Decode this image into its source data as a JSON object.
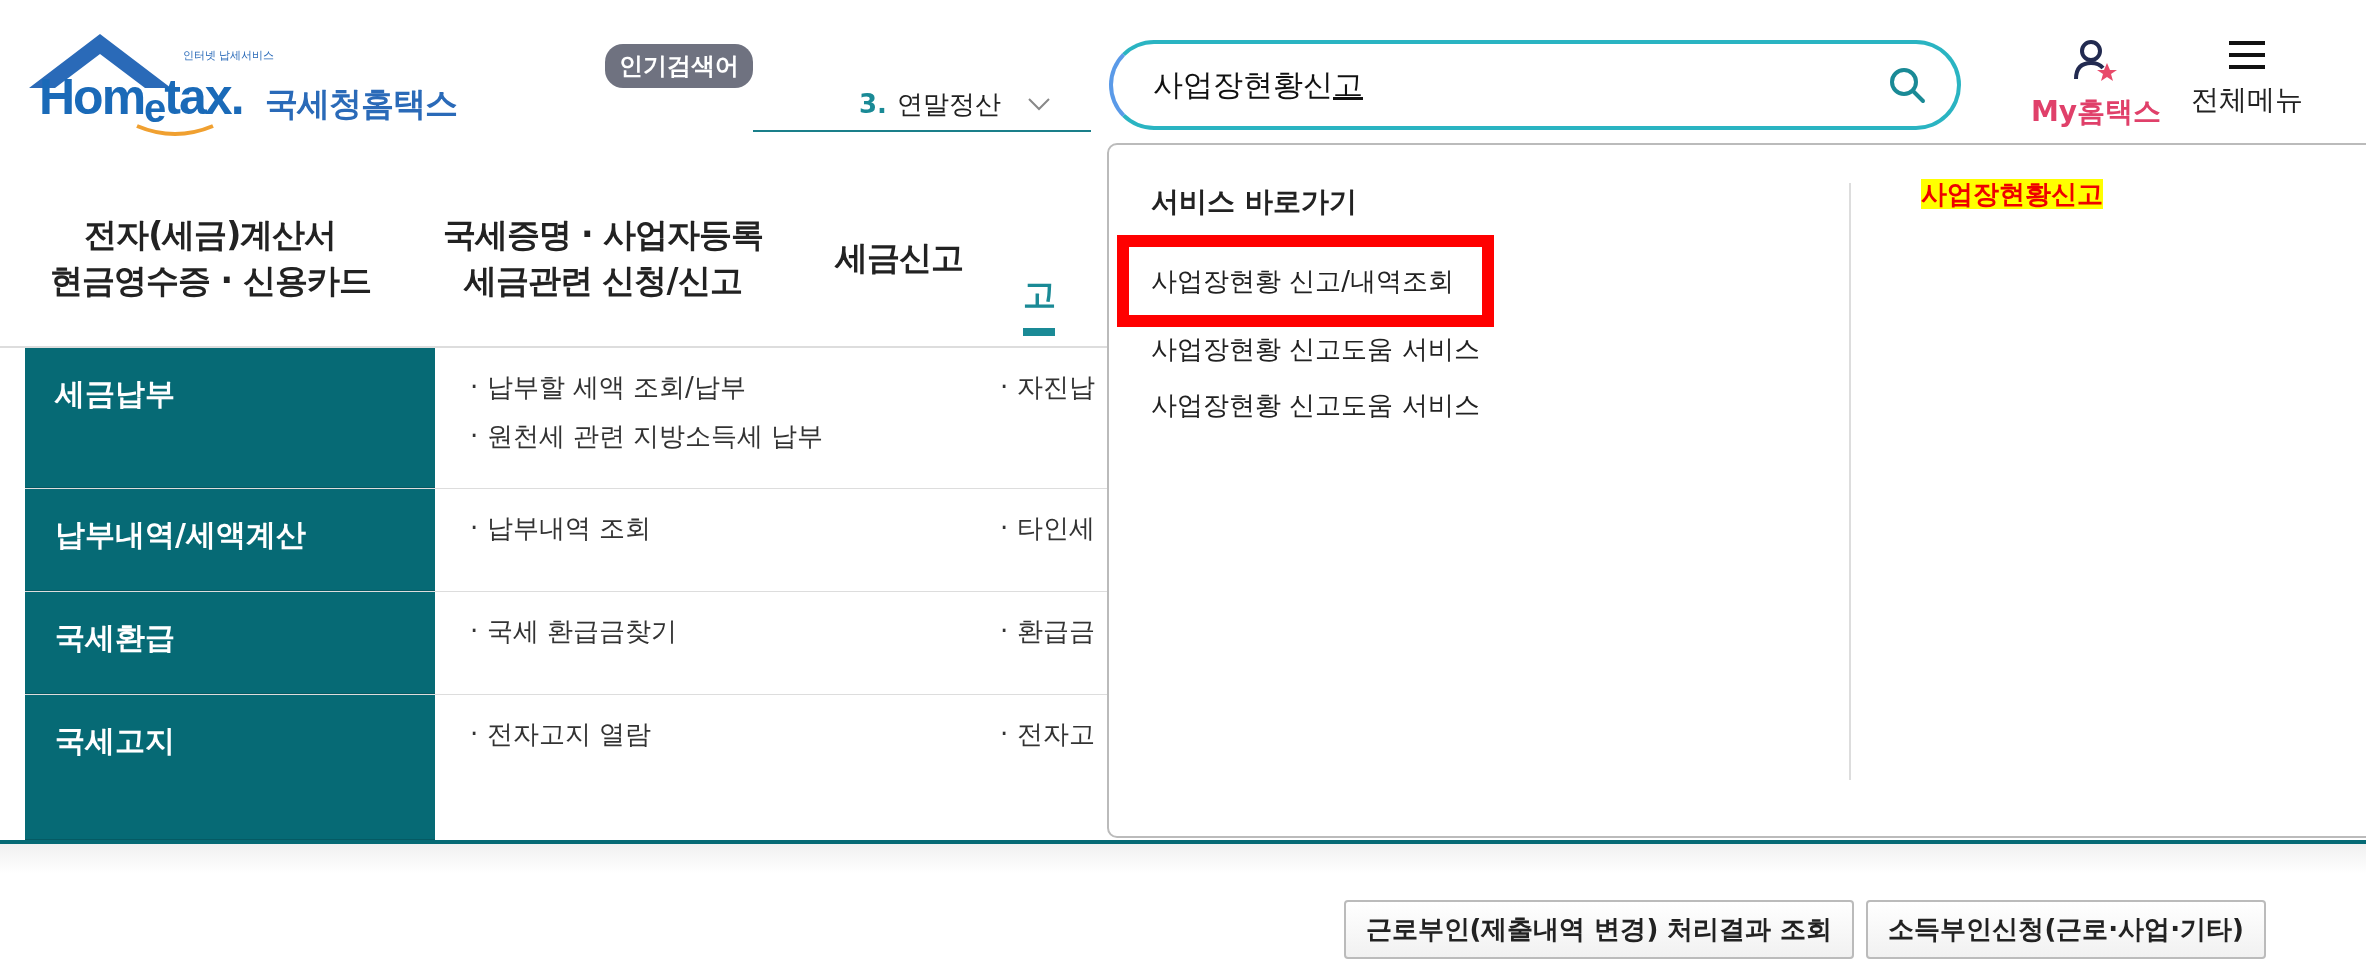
{
  "logo": {
    "tagline": "인터넷 납세서비스",
    "wordmark": "Hom$_{e}$tax.",
    "name": "국세청홈택스"
  },
  "popular": {
    "badge": "인기검색어",
    "rank": "3.",
    "term": "연말정산"
  },
  "search": {
    "value": "사업장현황신",
    "composing": "고"
  },
  "utility": [
    {
      "kind": "my",
      "label": "My홈택스"
    },
    {
      "kind": "menu",
      "label": "전체메뉴"
    }
  ],
  "nav": [
    {
      "lines": [
        "전자(세금)계산서",
        "현금영수증 · 신용카드"
      ],
      "selected": false
    },
    {
      "lines": [
        "국세증명 · 사업자등록",
        "세금관련 신청/신고"
      ],
      "selected": false
    },
    {
      "lines": [
        "세금신고"
      ],
      "selected": false
    },
    {
      "lines": [
        "고"
      ],
      "selected": true
    }
  ],
  "submenu": [
    {
      "title": "세금납부",
      "items": [
        [
          "· 납부할 세액 조회/납부",
          "· 원천세 관련 지방소득세 납부"
        ],
        [
          "· 자진납"
        ]
      ]
    },
    {
      "title": "납부내역/세액계산",
      "items": [
        [
          "· 납부내역 조회"
        ],
        [
          "· 타인세"
        ]
      ]
    },
    {
      "title": "국세환급",
      "items": [
        [
          "· 국세 환급금찾기"
        ],
        [
          "· 환급금"
        ]
      ]
    },
    {
      "title": "국세고지",
      "items": [
        [
          "· 전자고지 열람"
        ],
        [
          "· 전자고"
        ]
      ]
    }
  ],
  "dropdown": {
    "heading": "서비스 바로가기",
    "items": [
      {
        "label": "사업장현황 신고/내역조회",
        "highlighted": true
      },
      {
        "label": "사업장현황 신고도움 서비스",
        "highlighted": false
      },
      {
        "label": "사업장현황 신고도움 서비스",
        "highlighted": false
      }
    ],
    "keyword": "사업장현황신고"
  },
  "buttons": [
    "근로부인(제출내역 변경) 처리결과 조회",
    "소득부인신청(근로·사업·기타)"
  ]
}
